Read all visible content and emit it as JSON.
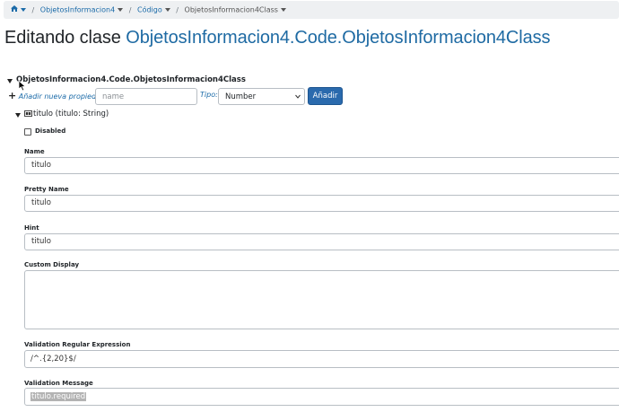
{
  "breadcrumb": {
    "home_icon": "home-icon",
    "items": [
      "ObjetosInformacion4",
      "Código",
      "ObjetosInformacion4Class"
    ]
  },
  "title": {
    "prefix": "Editando clase",
    "class_name": "ObjetosInformacion4.Code.ObjetosInformacion4Class"
  },
  "tree": {
    "root_label": "ObjetosInformacion4.Code.ObjetosInformacion4Class",
    "add_property_link": "Añadir nueva propiedad",
    "name_placeholder": "name",
    "type_label": "Tipo:",
    "type_selected": "Number",
    "add_button": "Añadir",
    "property_label": "titulo (titulo: String)"
  },
  "form": {
    "disabled_label": "Disabled",
    "name_label": "Name",
    "name_value": "titulo",
    "pretty_name_label": "Pretty Name",
    "pretty_name_value": "titulo",
    "hint_label": "Hint",
    "hint_value": "titulo",
    "custom_display_label": "Custom Display",
    "custom_display_value": "",
    "validation_regex_label": "Validation Regular Expression",
    "validation_regex_value": "/^.{2,20}$/",
    "validation_message_label": "Validation Message",
    "validation_message_value": "titulo.required"
  },
  "colors": {
    "link": "#1a6aa8",
    "title_class": "#1e6aa3",
    "button_primary": "#2a6aad",
    "breadcrumb_bg": "#eef0f2"
  }
}
